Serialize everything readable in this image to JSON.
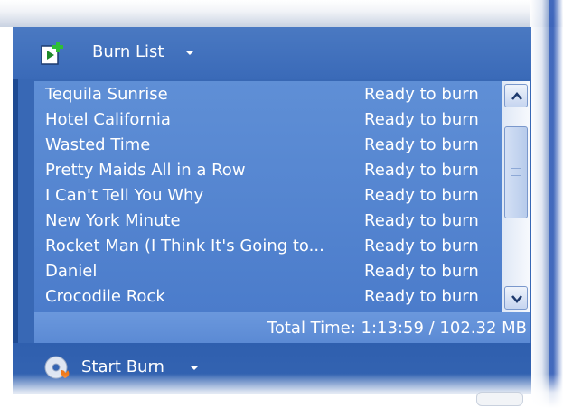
{
  "header": {
    "burn_list_label": "Burn List",
    "icon": "add-file-icon"
  },
  "tracks": [
    {
      "title": "Tequila Sunrise",
      "status": "Ready to burn"
    },
    {
      "title": "Hotel California",
      "status": "Ready to burn"
    },
    {
      "title": "Wasted Time",
      "status": "Ready to burn"
    },
    {
      "title": "Pretty Maids All in a Row",
      "status": "Ready to burn"
    },
    {
      "title": "I Can't Tell You Why",
      "status": "Ready to burn"
    },
    {
      "title": "New York Minute",
      "status": "Ready to burn"
    },
    {
      "title": "Rocket Man (I Think It's Going to...",
      "status": "Ready to burn"
    },
    {
      "title": "Daniel",
      "status": "Ready to burn"
    },
    {
      "title": "Crocodile Rock",
      "status": "Ready to burn"
    }
  ],
  "footer": {
    "total_time": "Total Time: 1:13:59 / 102.32 MB",
    "start_burn_label": "Start Burn",
    "icon": "burn-disc-icon"
  },
  "colors": {
    "panel": "#3868b5",
    "list": "#5f8fd6",
    "accent_green": "#2e9d2e"
  }
}
